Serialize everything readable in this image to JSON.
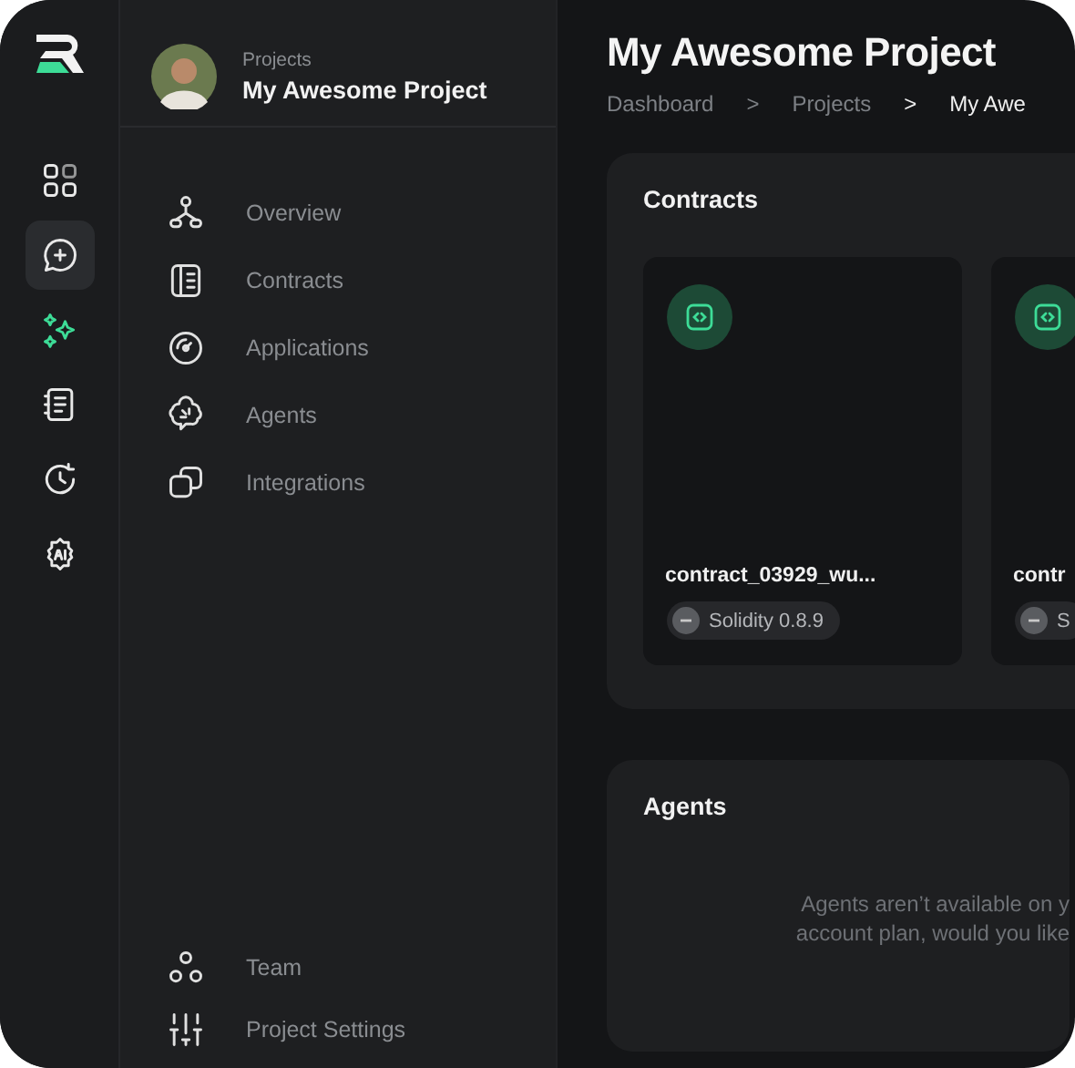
{
  "rail": [
    {
      "kind": "grid",
      "selected": false
    },
    {
      "kind": "chat-plus",
      "selected": true
    },
    {
      "kind": "sparkle",
      "selected": false
    },
    {
      "kind": "notebook",
      "selected": false
    },
    {
      "kind": "history",
      "selected": false
    },
    {
      "kind": "ai",
      "selected": false
    }
  ],
  "project_header": {
    "label": "Projects",
    "title": "My Awesome Project"
  },
  "nav": {
    "items": [
      {
        "kind": "overview",
        "label": "Overview"
      },
      {
        "kind": "contracts",
        "label": "Contracts"
      },
      {
        "kind": "applications",
        "label": "Applications"
      },
      {
        "kind": "agents",
        "label": "Agents"
      },
      {
        "kind": "integrations",
        "label": "Integrations"
      }
    ],
    "bottom_items": [
      {
        "kind": "team",
        "label": "Team"
      },
      {
        "kind": "settings",
        "label": "Project Settings"
      }
    ]
  },
  "page": {
    "title": "My Awesome Project",
    "breadcrumb": [
      "Dashboard",
      "Projects",
      "My Awe"
    ],
    "separators": [
      ">",
      ">"
    ]
  },
  "contracts": {
    "title": "Contracts",
    "cards": [
      {
        "name": "contract_03929_wu...",
        "language": "Solidity 0.8.9"
      },
      {
        "name": "contr",
        "language": "S"
      }
    ]
  },
  "agents": {
    "title": "Agents",
    "message_lines": [
      "Agents aren’t available on y",
      "account plan, would you like"
    ]
  }
}
